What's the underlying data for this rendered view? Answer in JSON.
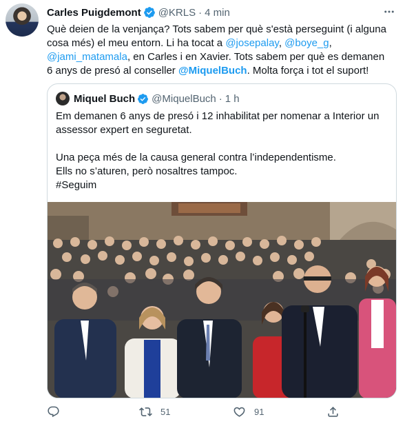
{
  "tweet": {
    "author_name": "Carles Puigdemont",
    "handle": "@KRLS",
    "separator": "·",
    "time": "4 min",
    "text_segments": [
      {
        "t": "Què deien de la venjança? Tots sabem per què s'està perseguint (i alguna cosa més) el meu entorn. Li ha tocat a ",
        "type": "text"
      },
      {
        "t": "@josepalay",
        "type": "mention"
      },
      {
        "t": ", ",
        "type": "text"
      },
      {
        "t": "@boye_g",
        "type": "mention"
      },
      {
        "t": ", ",
        "type": "text"
      },
      {
        "t": "@jami_matamala",
        "type": "mention"
      },
      {
        "t": ", en Carles i en Xavier. Tots sabem per què es demanen 6 anys de presó al conseller ",
        "type": "text"
      },
      {
        "t": "@MiquelBuch",
        "type": "mention-bold"
      },
      {
        "t": ". Molta força i tot el suport!",
        "type": "text"
      }
    ]
  },
  "quote": {
    "author_name": "Miquel Buch",
    "handle": "@MiquelBuch",
    "separator": "·",
    "time": "1 h",
    "lines": [
      "Em demanen 6 anys de presó i 12 inhabilitat per nomenar a Interior un assessor expert en seguretat.",
      "",
      "Una peça més de la causa general contra l’independentisme.",
      "Ells no s’aturen, però nosaltres tampoc.",
      "#Seguim"
    ]
  },
  "actions": {
    "reply_count": "",
    "retweet_count": "51",
    "like_count": "91"
  },
  "colors": {
    "link": "#1d9bf0",
    "secondary_text": "#536471",
    "border": "#cfd9de",
    "verified": "#1d9bf0"
  },
  "icons": [
    "verified-badge-icon",
    "more-icon",
    "reply-icon",
    "retweet-icon",
    "like-icon",
    "share-icon"
  ]
}
